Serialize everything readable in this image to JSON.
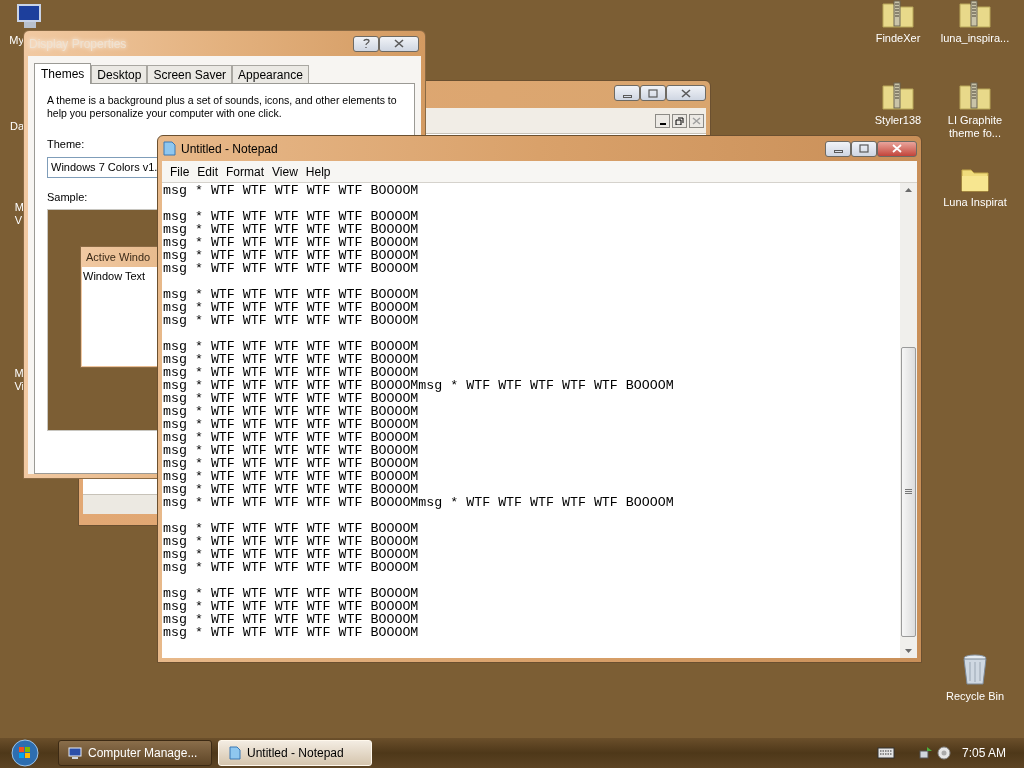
{
  "desktop_icons": [
    {
      "label": "My",
      "kind": "computer"
    },
    {
      "label": "Da",
      "kind": "hidden"
    },
    {
      "label": "M\nV",
      "kind": "hidden"
    },
    {
      "label": "M\nVi",
      "kind": "hidden"
    },
    {
      "label": "FindeXer",
      "kind": "zip"
    },
    {
      "label": "luna_inspira...",
      "kind": "zip"
    },
    {
      "label": "Styler138",
      "kind": "zip"
    },
    {
      "label": "LI Graphite\ntheme fo...",
      "kind": "zip"
    },
    {
      "label": "Luna Inspirat",
      "kind": "folder"
    },
    {
      "label": "Recycle Bin",
      "kind": "recycle"
    }
  ],
  "display_properties": {
    "title": "Display Properties",
    "tabs": [
      {
        "label": "Themes",
        "selected": true
      },
      {
        "label": "Desktop",
        "selected": false
      },
      {
        "label": "Screen Saver",
        "selected": false
      },
      {
        "label": "Appearance",
        "selected": false
      }
    ],
    "description": "A theme is a background plus a set of sounds, icons, and other elements to help you personalize your computer with one click.",
    "theme_label": "Theme:",
    "theme_value": "Windows 7 Colors v1.",
    "sample_label": "Sample:",
    "sample": {
      "active_title": "Active Windo",
      "window_text": "Window Text"
    }
  },
  "notepad": {
    "title": "Untitled - Notepad",
    "menu": [
      "File",
      "Edit",
      "Format",
      "View",
      "Help"
    ],
    "text": "msg * WTF WTF WTF WTF WTF BOOOOM\n\nmsg * WTF WTF WTF WTF WTF BOOOOM\nmsg * WTF WTF WTF WTF WTF BOOOOM\nmsg * WTF WTF WTF WTF WTF BOOOOM\nmsg * WTF WTF WTF WTF WTF BOOOOM\nmsg * WTF WTF WTF WTF WTF BOOOOM\n\nmsg * WTF WTF WTF WTF WTF BOOOOM\nmsg * WTF WTF WTF WTF WTF BOOOOM\nmsg * WTF WTF WTF WTF WTF BOOOOM\n\nmsg * WTF WTF WTF WTF WTF BOOOOM\nmsg * WTF WTF WTF WTF WTF BOOOOM\nmsg * WTF WTF WTF WTF WTF BOOOOM\nmsg * WTF WTF WTF WTF WTF BOOOOMmsg * WTF WTF WTF WTF WTF BOOOOM\nmsg * WTF WTF WTF WTF WTF BOOOOM\nmsg * WTF WTF WTF WTF WTF BOOOOM\nmsg * WTF WTF WTF WTF WTF BOOOOM\nmsg * WTF WTF WTF WTF WTF BOOOOM\nmsg * WTF WTF WTF WTF WTF BOOOOM\nmsg * WTF WTF WTF WTF WTF BOOOOM\nmsg * WTF WTF WTF WTF WTF BOOOOM\nmsg * WTF WTF WTF WTF WTF BOOOOM\nmsg * WTF WTF WTF WTF WTF BOOOOMmsg * WTF WTF WTF WTF WTF BOOOOM\n\nmsg * WTF WTF WTF WTF WTF BOOOOM\nmsg * WTF WTF WTF WTF WTF BOOOOM\nmsg * WTF WTF WTF WTF WTF BOOOOM\nmsg * WTF WTF WTF WTF WTF BOOOOM\n\nmsg * WTF WTF WTF WTF WTF BOOOOM\nmsg * WTF WTF WTF WTF WTF BOOOOM\nmsg * WTF WTF WTF WTF WTF BOOOOM\nmsg * WTF WTF WTF WTF WTF BOOOOM"
  },
  "taskbar": {
    "buttons": [
      {
        "label": "Computer Manage...",
        "kind": "computer",
        "selected": false
      },
      {
        "label": "Untitled - Notepad",
        "kind": "notepad",
        "selected": true
      }
    ],
    "clock": "7:05 AM"
  }
}
